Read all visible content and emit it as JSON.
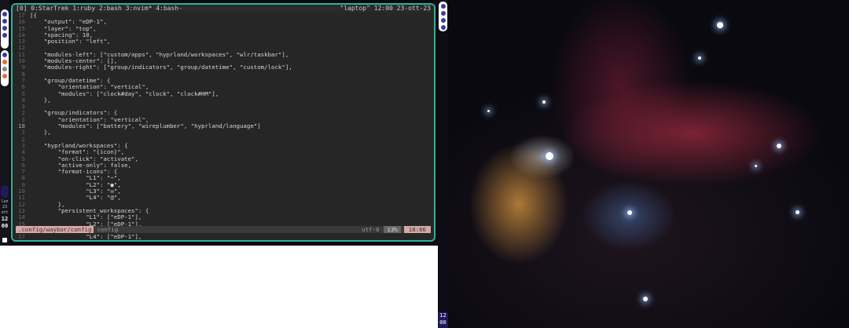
{
  "tmux": {
    "session": "[0]",
    "windows": "0:StarTrek  1:ruby  2:bash  3:nvim* 4:bash-",
    "right": "\"laptop\" 12:00 23-ott-23"
  },
  "editor": {
    "lines": [
      {
        "n": "17",
        "t": "[{"
      },
      {
        "n": "16",
        "t": "    \"output\": \"eDP-1\","
      },
      {
        "n": "15",
        "t": "    \"layer\": \"top\","
      },
      {
        "n": "14",
        "t": "    \"spacing\": 10,"
      },
      {
        "n": "13",
        "t": "    \"position\": \"left\","
      },
      {
        "n": "12",
        "t": ""
      },
      {
        "n": "11",
        "t": "    \"modules-left\": [\"custom/apps\", \"hyprland/workspaces\", \"wlr/taskbar\"],"
      },
      {
        "n": "10",
        "t": "    \"modules-center\": [],"
      },
      {
        "n": "9",
        "t": "    \"modules-right\": [\"group/indicators\", \"group/datetime\", \"custom/lock\"],"
      },
      {
        "n": "8",
        "t": ""
      },
      {
        "n": "7",
        "t": "    \"group/datetime\": {"
      },
      {
        "n": "6",
        "t": "        \"orientation\": \"vertical\","
      },
      {
        "n": "5",
        "t": "        \"modules\": [\"clock#day\", \"clock\", \"clock#HM\"],"
      },
      {
        "n": "4",
        "t": "    },"
      },
      {
        "n": "3",
        "t": ""
      },
      {
        "n": "2",
        "t": "    \"group/indicators\": {"
      },
      {
        "n": "1",
        "t": "        \"orientation\": \"vertical\","
      },
      {
        "n": "18",
        "t": "        \"modules\": [\"battery\", \"wireplumber\", \"hyprland/language\"]"
      },
      {
        "n": "1",
        "t": "    },"
      },
      {
        "n": "2",
        "t": ""
      },
      {
        "n": "3",
        "t": "    \"hyprland/workspaces\": {"
      },
      {
        "n": "4",
        "t": "        \"format\": \"{icon}\","
      },
      {
        "n": "5",
        "t": "        \"on-click\": \"activate\","
      },
      {
        "n": "6",
        "t": "        \"active-only\": false,"
      },
      {
        "n": "7",
        "t": "        \"format-icons\": {"
      },
      {
        "n": "8",
        "t": "                \"L1\": \"~\","
      },
      {
        "n": "9",
        "t": "                \"L2\": \"●\","
      },
      {
        "n": "10",
        "t": "                \"L3\": \"✉\","
      },
      {
        "n": "11",
        "t": "                \"L4\": \"@\","
      },
      {
        "n": "12",
        "t": "        },"
      },
      {
        "n": "13",
        "t": "        \"persistent_workspaces\": {"
      },
      {
        "n": "14",
        "t": "                \"L1\": [\"eDP-1\"],"
      },
      {
        "n": "15",
        "t": "                \"L2\": [\"eDP-1\"],"
      },
      {
        "n": "16",
        "t": "                \"L3\": [\"eDP-1\"],"
      },
      {
        "n": "17",
        "t": "                \"L4\": [\"eDP-1\"],"
      }
    ]
  },
  "statusline": {
    "path": ".config/waybar/config",
    "filetype": "config",
    "encoding": "utf-8",
    "percent": "13%",
    "position": "18:66"
  },
  "left_bar": {
    "day": "lun",
    "date": "23",
    "month": "ott",
    "hour": "12",
    "minute": "00"
  },
  "right_bar": {
    "hour": "12",
    "minute": "00"
  },
  "colors": {
    "border": "#2bb39a",
    "statusline": "#d7a6a6",
    "bar_accent": "#201a5a"
  }
}
